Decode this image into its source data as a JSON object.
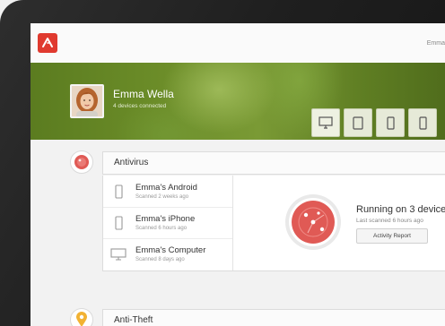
{
  "app": {
    "brand_color": "#e03a2f",
    "logo_icon": "avira-umbrella-icon"
  },
  "topbar": {
    "user_label": "Emma"
  },
  "profile": {
    "name": "Emma Wella",
    "subtitle": "4 devices connected",
    "device_tabs": [
      {
        "icon": "monitor-icon"
      },
      {
        "icon": "tablet-icon"
      },
      {
        "icon": "phone-icon"
      },
      {
        "icon": "phone-icon"
      }
    ]
  },
  "sections": {
    "antivirus": {
      "title": "Antivirus",
      "icon": "antivirus-shield-icon",
      "devices": [
        {
          "name": "Emma's Android",
          "scanned": "Scanned 2 weeks ago",
          "icon": "phone-icon"
        },
        {
          "name": "Emma's iPhone",
          "scanned": "Scanned 6 hours ago",
          "icon": "phone-icon"
        },
        {
          "name": "Emma's Computer",
          "scanned": "Scanned 8 days ago",
          "icon": "monitor-icon"
        }
      ],
      "status_title": "Running on 3 device",
      "status_sub": "Last scanned 6 hours ago",
      "report_button": "Activity Report",
      "accent_color": "#e05a55"
    },
    "antitheft": {
      "title": "Anti-Theft",
      "icon": "location-pin-icon",
      "accent_color": "#f2b233"
    }
  }
}
